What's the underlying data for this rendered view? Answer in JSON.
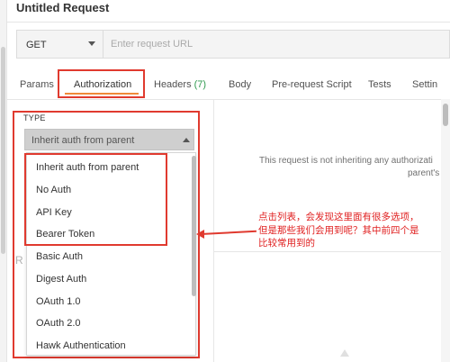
{
  "header": {
    "title": "Untitled Request"
  },
  "request": {
    "method": "GET",
    "url_placeholder": "Enter request URL",
    "url_value": ""
  },
  "tabs": [
    {
      "label": "Params"
    },
    {
      "label": "Authorization",
      "active": true
    },
    {
      "label": "Headers",
      "count": "(7)"
    },
    {
      "label": "Body"
    },
    {
      "label": "Pre-request Script"
    },
    {
      "label": "Tests"
    },
    {
      "label": "Settin"
    }
  ],
  "auth": {
    "type_label": "TYPE",
    "selected": "Inherit auth from parent",
    "options": [
      "Inherit auth from parent",
      "No Auth",
      "API Key",
      "Bearer Token",
      "Basic Auth",
      "Digest Auth",
      "OAuth 1.0",
      "OAuth 2.0",
      "Hawk Authentication"
    ],
    "info_line1": "This request is not inheriting any authorizati",
    "info_line2": "parent's",
    "hidden_letter": "R"
  },
  "annotation": {
    "line1": "点击列表，会发现这里面有很多选项，",
    "line2": "但是那些我们会用到呢？其中前四个是",
    "line3": "比较常用到的"
  },
  "colors": {
    "highlight": "#e03a2f",
    "active_underline": "#f08a3a",
    "count": "#2f9a4f",
    "annotation_text": "#e02020"
  }
}
